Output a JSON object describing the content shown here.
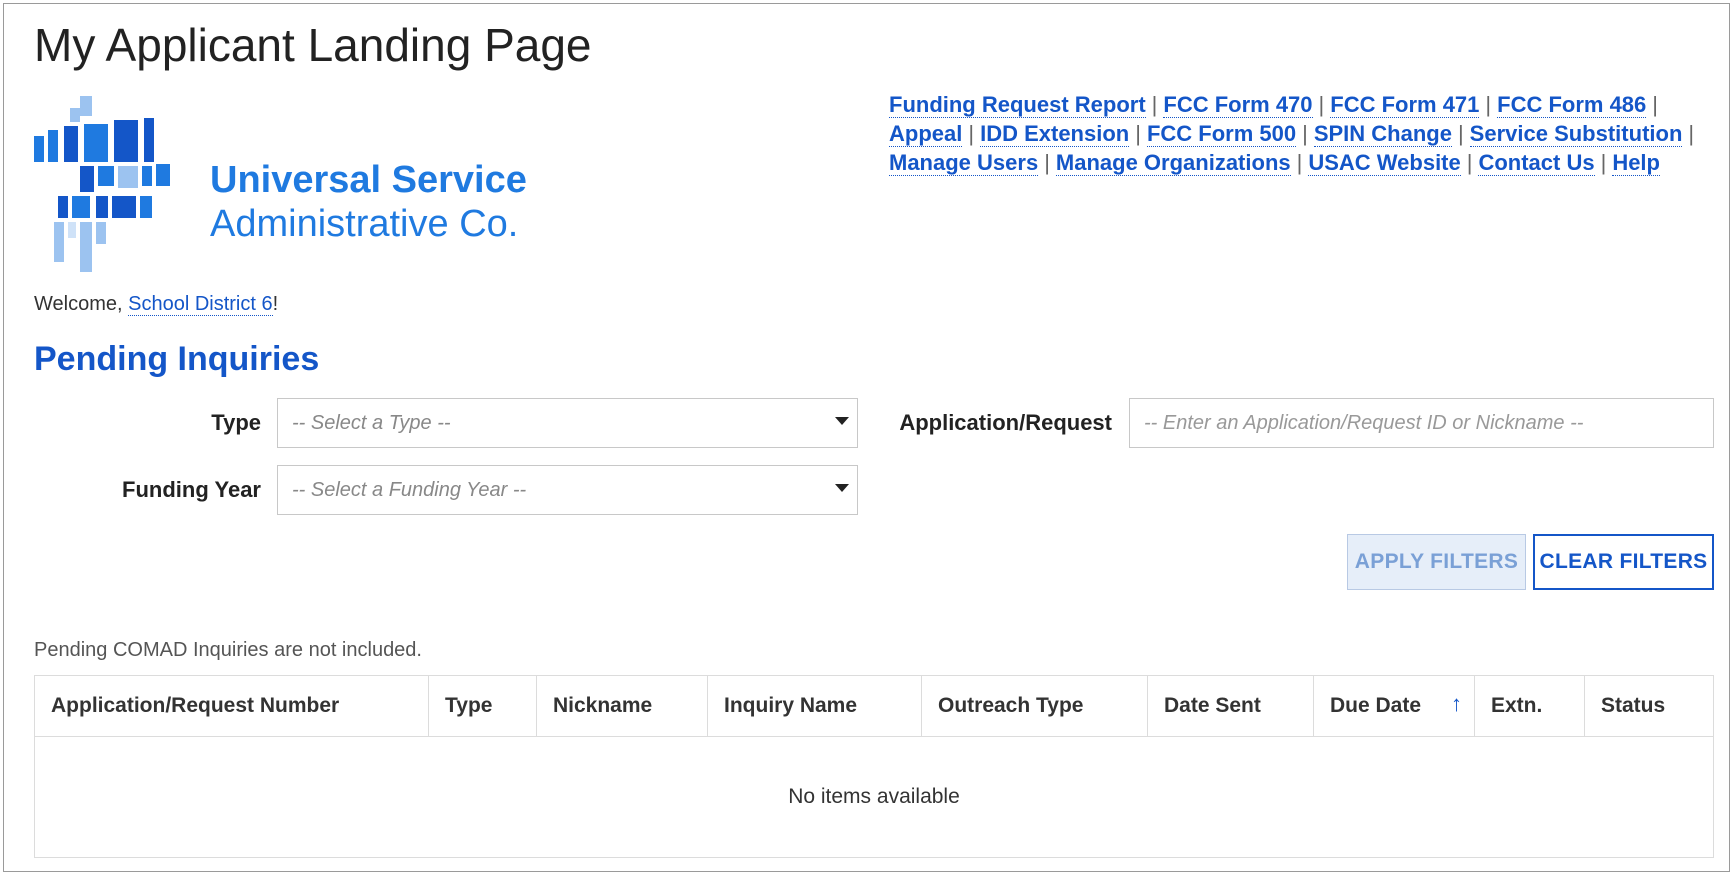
{
  "page": {
    "title": "My Applicant Landing Page"
  },
  "logo": {
    "line1": "Universal Service",
    "line2": "Administrative Co.",
    "brand_color": "#1f7ae0"
  },
  "nav": {
    "links": [
      "Funding Request Report",
      "FCC Form 470",
      "FCC Form 471",
      "FCC Form 486",
      "Appeal",
      "IDD Extension",
      "FCC Form 500",
      "SPIN Change",
      "Service Substitution",
      "Manage Users",
      "Manage Organizations",
      "USAC Website",
      "Contact Us",
      "Help"
    ],
    "separator": "|"
  },
  "welcome": {
    "prefix": "Welcome, ",
    "org_name": "School District 6",
    "suffix": "!"
  },
  "section": {
    "title": "Pending Inquiries"
  },
  "filters": {
    "type_label": "Type",
    "type_placeholder": "-- Select a Type --",
    "funding_year_label": "Funding Year",
    "funding_year_placeholder": "-- Select a Funding Year --",
    "app_request_label": "Application/Request",
    "app_request_placeholder": "-- Enter an Application/Request ID or Nickname --",
    "apply_label": "APPLY FILTERS",
    "clear_label": "CLEAR FILTERS"
  },
  "note": "Pending COMAD Inquiries are not included.",
  "table": {
    "columns": [
      "Application/Request Number",
      "Type",
      "Nickname",
      "Inquiry Name",
      "Outreach Type",
      "Date Sent",
      "Due Date",
      "Extn.",
      "Status"
    ],
    "sort_icon": "arrow-up-icon",
    "empty_message": "No items available"
  },
  "colors": {
    "link": "#1456c8",
    "accent": "#1456c8"
  }
}
